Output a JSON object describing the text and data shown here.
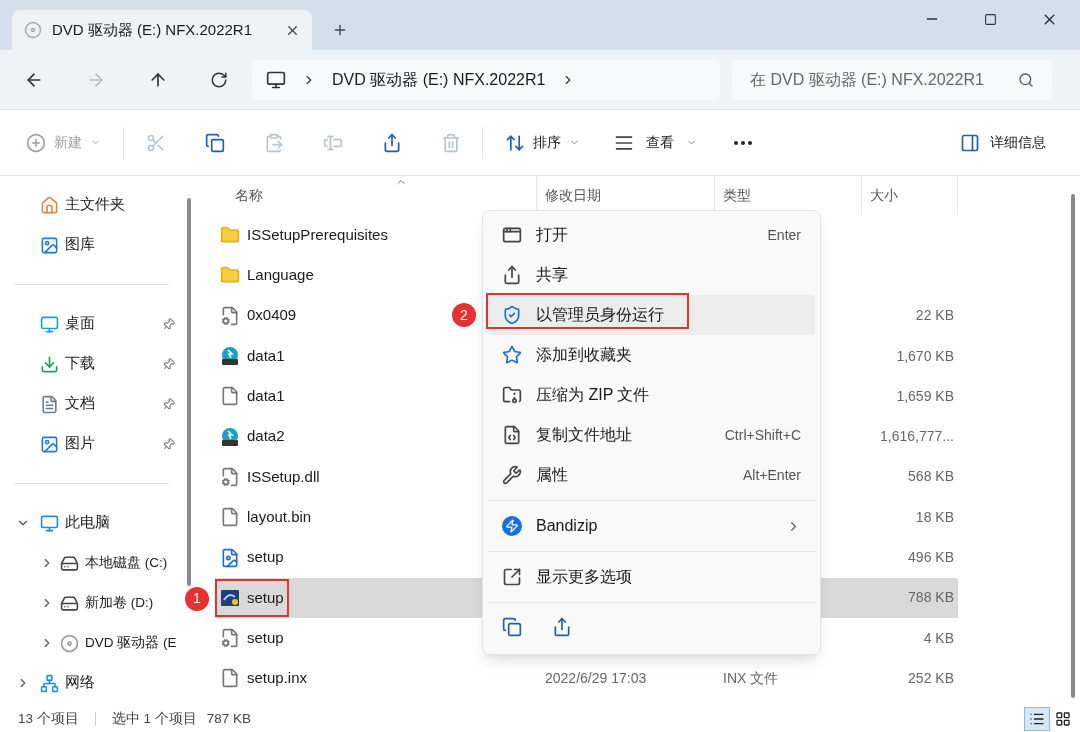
{
  "window": {
    "tab_title": "DVD 驱动器 (E:) NFX.2022R1"
  },
  "address": {
    "forward_disabled": true,
    "path": [
      "DVD 驱动器 (E:) NFX.2022R1"
    ],
    "search_placeholder": "在 DVD 驱动器 (E:) NFX.2022R1"
  },
  "toolbar": {
    "new": {
      "label": "新建",
      "disabled": true
    },
    "actions": [
      {
        "kind": "cut",
        "disabled": true
      },
      {
        "kind": "copy",
        "disabled": false
      },
      {
        "kind": "paste",
        "disabled": true
      },
      {
        "kind": "rename",
        "disabled": true
      },
      {
        "kind": "share",
        "disabled": false
      },
      {
        "kind": "delete",
        "disabled": true
      }
    ],
    "sort": "排序",
    "view": "查看",
    "details": "详细信息"
  },
  "sidebar": {
    "groups": [
      {
        "items": [
          {
            "kind": "home",
            "label": "主文件夹",
            "pinned": false
          },
          {
            "kind": "gallery",
            "label": "图库",
            "pinned": false
          }
        ]
      },
      {
        "items": [
          {
            "kind": "desktop",
            "label": "桌面",
            "pinned": true
          },
          {
            "kind": "download",
            "label": "下载",
            "pinned": true
          },
          {
            "kind": "document",
            "label": "文档",
            "pinned": true
          },
          {
            "kind": "gallery",
            "label": "图片",
            "pinned": true
          }
        ]
      },
      {
        "items": [
          {
            "kind": "pc",
            "label": "此电脑",
            "expanded": true,
            "children": [
              {
                "kind": "drive",
                "label": "本地磁盘 (C:)",
                "expanded": false
              },
              {
                "kind": "drive",
                "label": "新加卷 (D:)",
                "expanded": false
              },
              {
                "kind": "disc",
                "label": "DVD 驱动器 (E",
                "expanded": false
              }
            ]
          },
          {
            "kind": "network",
            "label": "网络",
            "expanded": false
          }
        ]
      }
    ]
  },
  "files": {
    "columns": [
      "名称",
      "修改日期",
      "类型",
      "大小"
    ],
    "rows": [
      {
        "kind": "folder",
        "name": "ISSetupPrerequisites",
        "selected": false
      },
      {
        "kind": "folder",
        "name": "Language",
        "selected": false
      },
      {
        "kind": "settings",
        "name": "0x0409",
        "size": "22 KB",
        "selected": false
      },
      {
        "kind": "cab",
        "name": "data1",
        "size": "1,670 KB",
        "selected": false
      },
      {
        "kind": "blank",
        "name": "data1",
        "size": "1,659 KB",
        "selected": false
      },
      {
        "kind": "cab",
        "name": "data2",
        "size": "1,616,777...",
        "selected": false
      },
      {
        "kind": "settings",
        "name": "ISSetup.dll",
        "size": "568 KB",
        "selected": false
      },
      {
        "kind": "blank",
        "name": "layout.bin",
        "size": "18 KB",
        "selected": false
      },
      {
        "kind": "image",
        "name": "setup",
        "size": "496 KB",
        "selected": false
      },
      {
        "kind": "installer",
        "name": "setup",
        "size": "788 KB",
        "selected": true,
        "annotation": "1"
      },
      {
        "kind": "settings",
        "name": "setup",
        "size": "4 KB",
        "selected": false
      },
      {
        "kind": "blank",
        "name": "setup.inx",
        "date": "2022/6/29 17:03",
        "type": "INX 文件",
        "size": "252 KB",
        "selected": false
      }
    ]
  },
  "context_menu": {
    "sections": [
      {
        "items": [
          {
            "kind": "open",
            "label": "打开",
            "shortcut": "Enter",
            "selected": false
          },
          {
            "kind": "share",
            "label": "共享",
            "selected": false
          },
          {
            "kind": "admin",
            "label": "以管理员身份运行",
            "selected": true,
            "annotation": "2"
          },
          {
            "kind": "star",
            "label": "添加到收藏夹",
            "selected": false
          },
          {
            "kind": "zip",
            "label": "压缩为 ZIP 文件",
            "selected": false
          },
          {
            "kind": "path",
            "label": "复制文件地址",
            "shortcut": "Ctrl+Shift+C",
            "selected": false
          },
          {
            "kind": "wrench",
            "label": "属性",
            "shortcut": "Alt+Enter",
            "selected": false
          }
        ]
      },
      {
        "items": [
          {
            "kind": "bandizip",
            "label": "Bandizip",
            "submenu": true,
            "selected": false
          }
        ]
      },
      {
        "items": [
          {
            "kind": "more",
            "label": "显示更多选项",
            "selected": false
          }
        ]
      }
    ]
  },
  "status_bar": {
    "count": "13 个项目",
    "selection": "选中 1 个项目",
    "selection_size": "787 KB",
    "views": [
      {
        "kind": "details",
        "selected": true
      },
      {
        "kind": "tiles",
        "selected": false
      }
    ]
  }
}
